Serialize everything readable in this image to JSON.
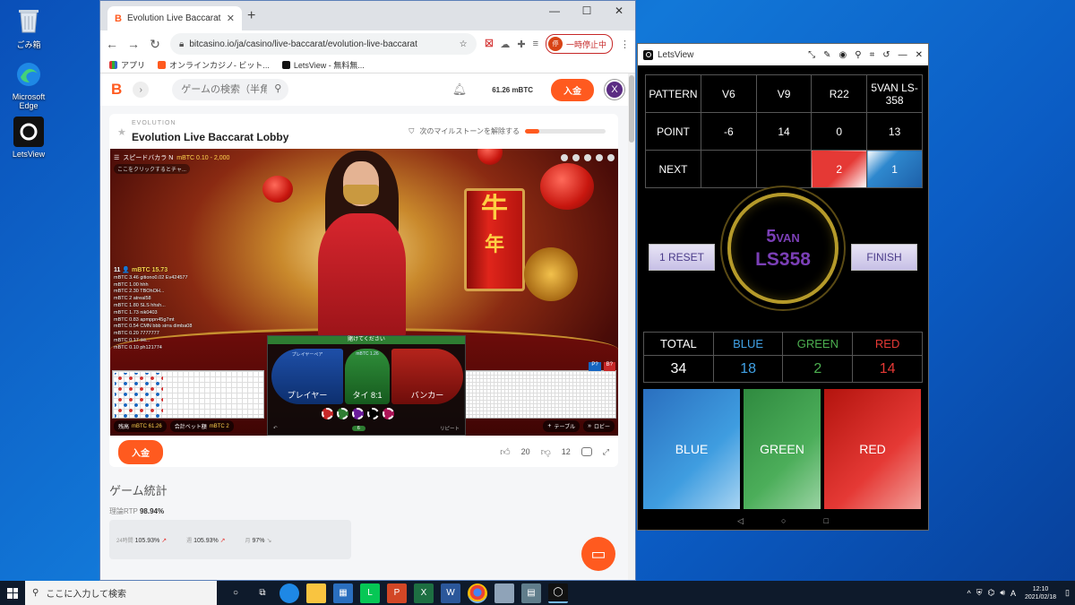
{
  "desktop": {
    "icons": [
      {
        "label": "ごみ箱"
      },
      {
        "label": "Microsoft Edge"
      },
      {
        "label": "LetsView"
      }
    ]
  },
  "browser": {
    "tab_title": "Evolution Live Baccarat Lobb",
    "url": "bitcasino.io/ja/casino/live-baccarat/evolution-live-baccarat",
    "pause_label": "一時停止中",
    "bookmarks": [
      "アプリ",
      "オンラインカジノ- ビット...",
      "LetsView - 無料無..."
    ]
  },
  "site": {
    "logo": "B",
    "search_placeholder": "ゲームの検索（半角）",
    "balance": "61.26 mBTC",
    "deposit_label": "入金",
    "avatar": "X"
  },
  "game": {
    "provider": "EVOLUTION",
    "title": "Evolution Live Baccarat Lobby",
    "milestone_label": "次のマイルストーンを解除する",
    "milestone_progress": 0.18,
    "video": {
      "table_name": "スピードバカラ N",
      "limits": "mBTC 0.10 - 2,000",
      "hint": "ここをクリックするとチャ...",
      "banner": "賭けてください",
      "player": "プレイヤー",
      "tie": "タイ 8:1",
      "banker": "バンカー",
      "player_mini": "プレイヤーペア",
      "tie_mini": "mBTC 1.26",
      "balance_label": "残高",
      "balance_value": "mBTC 61.26",
      "bet_label": "合計ベット額",
      "bet_value": "mBTC 2",
      "repeat": "リピート",
      "table_btn": "テーブル",
      "lobby_btn": "ロビー",
      "drum_char": "牛",
      "chat_header_count": "11",
      "chat_header_lim": "mBTC 15.73",
      "chat_lines": [
        "mBTC 3.46 gitiono0.02 Ev424577",
        "mBTC 1.00 hhh",
        "mBTC 2.30 TBOhOH...",
        "mBTC 2 atreal58",
        "mBTC 1.80 SLS hhsh...",
        "mBTC 1.73 nik0403",
        "mBTC 0.83 apmppn45g7mt",
        "mBTC 0.54 CMN bbb sirra dimba08",
        "mBTC 0.20 7777777",
        "mBTC 0.17 iHi...",
        "mBTC 0.10 ph121774"
      ]
    },
    "likes": "20",
    "dislikes": "12"
  },
  "stats": {
    "heading": "ゲーム統計",
    "rtp_label": "理論RTP",
    "rtp_value": "98.94%",
    "periods": [
      {
        "label": "24時間",
        "value": "105.93%",
        "trend": "up"
      },
      {
        "label": "週",
        "value": "105.93%",
        "trend": "up"
      },
      {
        "label": "月",
        "value": "97%",
        "trend": "down"
      }
    ]
  },
  "letsview": {
    "title": "LetsView",
    "pattern_table": {
      "rows": [
        [
          "PATTERN",
          "V6",
          "V9",
          "R22",
          "5VAN LS-358"
        ],
        [
          "POINT",
          "-6",
          "14",
          "0",
          "13"
        ],
        [
          "NEXT",
          "",
          "",
          "2",
          "1"
        ]
      ]
    },
    "reset_label": "1 RESET",
    "finish_label": "FINISH",
    "center_line1_big": "5",
    "center_line1_small": "VAN",
    "center_line2": "LS358",
    "totals": {
      "headers": [
        "TOTAL",
        "BLUE",
        "GREEN",
        "RED"
      ],
      "values": [
        "34",
        "18",
        "2",
        "14"
      ]
    },
    "buttons": [
      "BLUE",
      "GREEN",
      "RED"
    ]
  },
  "taskbar": {
    "search_placeholder": "ここに入力して検索",
    "time": "12:10",
    "date": "2021/02/18"
  },
  "colors": {
    "accent": "#ff5a1f",
    "blue": "#41a2e6",
    "green": "#4caf50",
    "red": "#e53935",
    "purple": "#7b3fb6"
  }
}
